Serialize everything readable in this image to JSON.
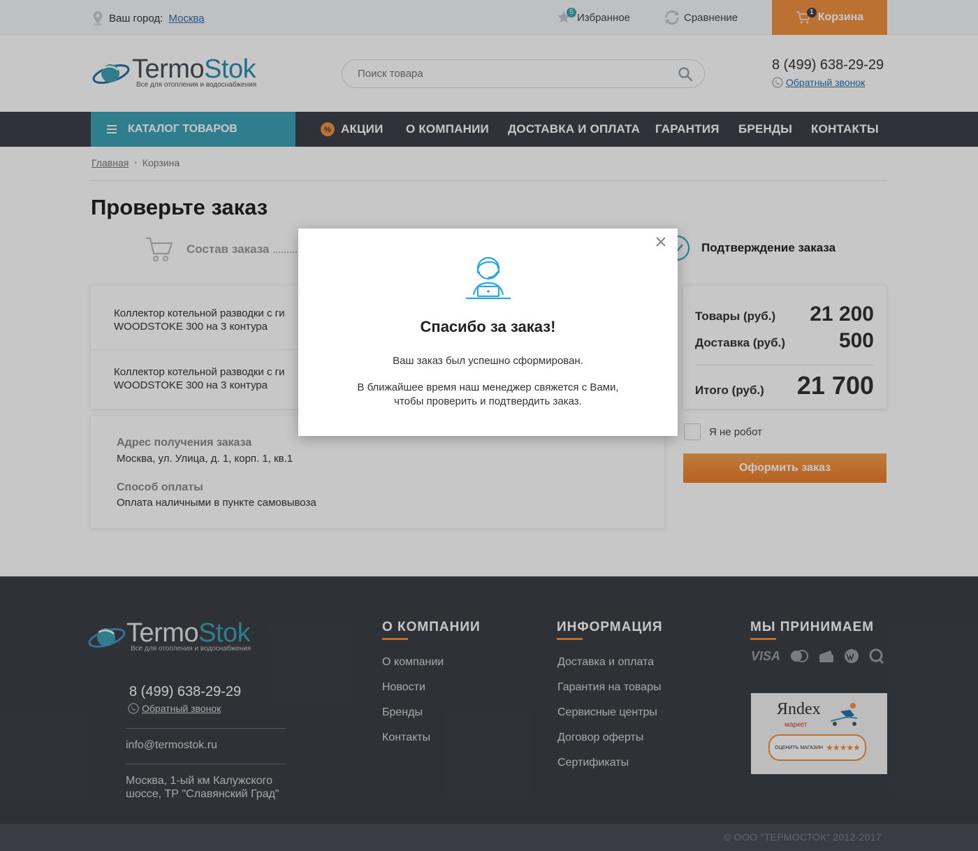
{
  "topbar": {
    "city_label": "Ваш город:",
    "city_name": "Москва",
    "favorites_label": "Избранное",
    "favorites_count": "5",
    "compare_label": "Сравнение",
    "cart_label": "Корзина",
    "cart_count": "1"
  },
  "header": {
    "logo_brand_1": "Termo",
    "logo_brand_2": "Stok",
    "logo_tagline": "Все для отопления и водоснабжения",
    "search_placeholder": "Поиск товара",
    "phone": "8 (499) 638-29-29",
    "callback": "Обратный звонок"
  },
  "nav": {
    "catalog": "КАТАЛОГ ТОВАРОВ",
    "items": [
      "АКЦИИ",
      "О КОМПАНИИ",
      "ДОСТАВКА И ОПЛАТА",
      "ГАРАНТИЯ",
      "БРЕНДЫ",
      "КОНТАКТЫ"
    ]
  },
  "breadcrumb": {
    "home": "Главная",
    "current": "Корзина"
  },
  "page": {
    "title": "Проверьте заказ",
    "step1": "Состав заказа",
    "step3": "Подтверждение заказа"
  },
  "items": [
    {
      "line1": "Коллектор котельной разводки с ги",
      "line2": "WOODSTOKE 300 на 3 контура"
    },
    {
      "line1": "Коллектор котельной разводки с ги",
      "line2": "WOODSTOKE 300 на 3 контура"
    }
  ],
  "delivery": {
    "address_label": "Адрес получения заказа",
    "address_value": "Москва, ул. Улица, д. 1, корп. 1, кв.1",
    "payment_label": "Способ оплаты",
    "payment_value": "Оплата наличными в пункте самовывоза"
  },
  "summary": {
    "goods_label": "Товары (руб.)",
    "goods_value": "21 200",
    "delivery_label": "Доставка (руб.)",
    "delivery_value": "500",
    "total_label": "Итого (руб.)",
    "total_value": "21 700",
    "robot_label": "Я не робот",
    "order_button": "Оформить заказ"
  },
  "modal": {
    "title": "Спасибо за заказ!",
    "text1": "Ваш заказ был успешно сформирован.",
    "text2": "В ближайшее время наш менеджер свяжется с Вами,",
    "text3": "чтобы проверить и подтвердить заказ."
  },
  "footer": {
    "phone": "8 (499) 638-29-29",
    "callback": "Обратный звонок",
    "email": "info@termostok.ru",
    "address_line1": "Москва, 1-ый км Калужского",
    "address_line2": "шоссе, ТР \"Славянский Град\"",
    "col1_title": "О КОМПАНИИ",
    "col1_links": [
      "О компании",
      "Новости",
      "Бренды",
      "Контакты"
    ],
    "col2_title": "ИНФОРМАЦИЯ",
    "col2_links": [
      "Доставка и оплата",
      "Гарантия на товары",
      "Сервисные центры",
      "Договор оферты",
      "Сертификаты"
    ],
    "col3_title": "МЫ ПРИНИМАЕМ",
    "payment_visa": "VISA",
    "yandex_logo": "Яndex",
    "yandex_market": "маркет",
    "yandex_rate": "ОЦЕНИТЬ МАГАЗИН",
    "copyright": "© ООО \"ТЕРМОСТОК\" 2012-2017"
  },
  "colors": {
    "accent_orange": "#f0913f",
    "catalog_teal": "#3ea2b5",
    "nav_dark": "#3d4148",
    "link_blue": "#2a6fb3",
    "modal_icon": "#29a9e0"
  },
  "icons": [
    "location-pin-icon",
    "star-icon",
    "compare-icon",
    "cart-icon",
    "search-icon",
    "phone-icon",
    "hamburger-icon",
    "percent-icon",
    "cart-step-icon",
    "operator-icon",
    "close-icon"
  ]
}
